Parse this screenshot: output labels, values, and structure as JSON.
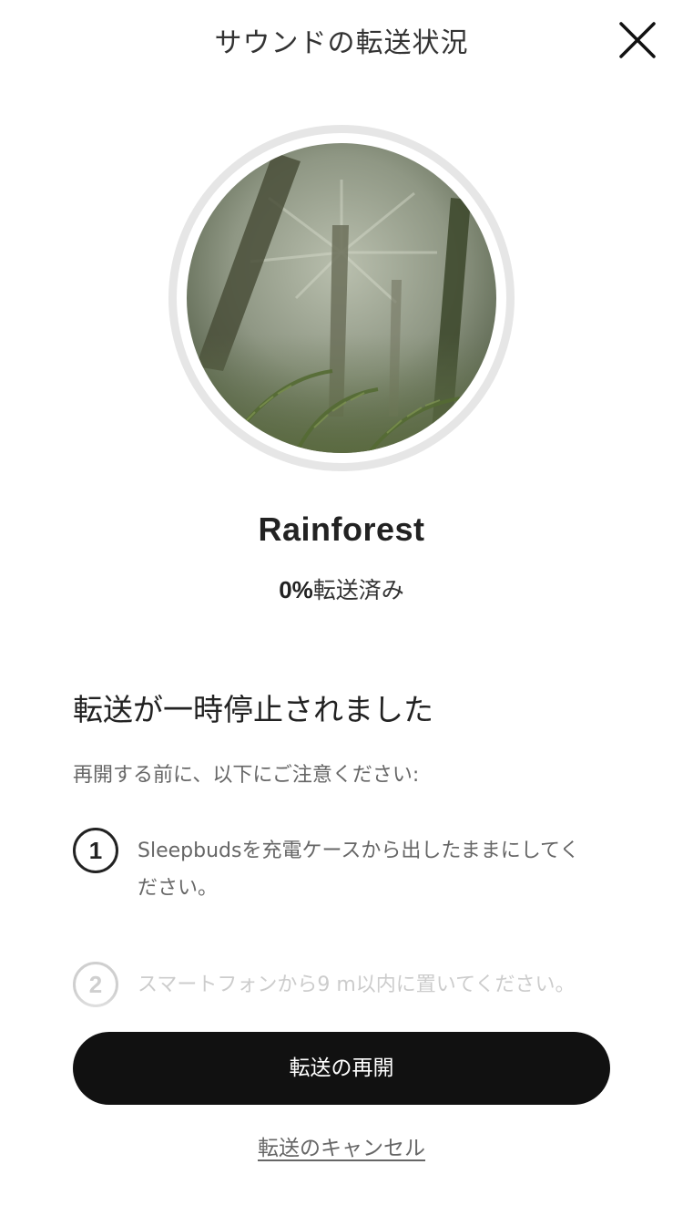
{
  "header": {
    "title": "サウンドの転送状況",
    "close_icon": "close-icon"
  },
  "sound": {
    "name": "Rainforest",
    "artwork": "rainforest-image",
    "progress_percent_value": 0,
    "progress_percent": "0%",
    "progress_suffix": "転送済み"
  },
  "notice": {
    "heading": "転送が一時停止されました",
    "intro": "再開する前に、以下にご注意ください:",
    "steps": [
      {
        "number": "1",
        "text": "Sleepbudsを充電ケースから出したままにしてください。"
      },
      {
        "number": "2",
        "text": "スマートフォンから9 m以内に置いてください。"
      }
    ]
  },
  "actions": {
    "resume_label": "転送の再開",
    "cancel_label": "転送のキャンセル"
  },
  "colors": {
    "primary_button": "#111111",
    "ring": "#e6e6e6",
    "muted_text": "#666666"
  }
}
